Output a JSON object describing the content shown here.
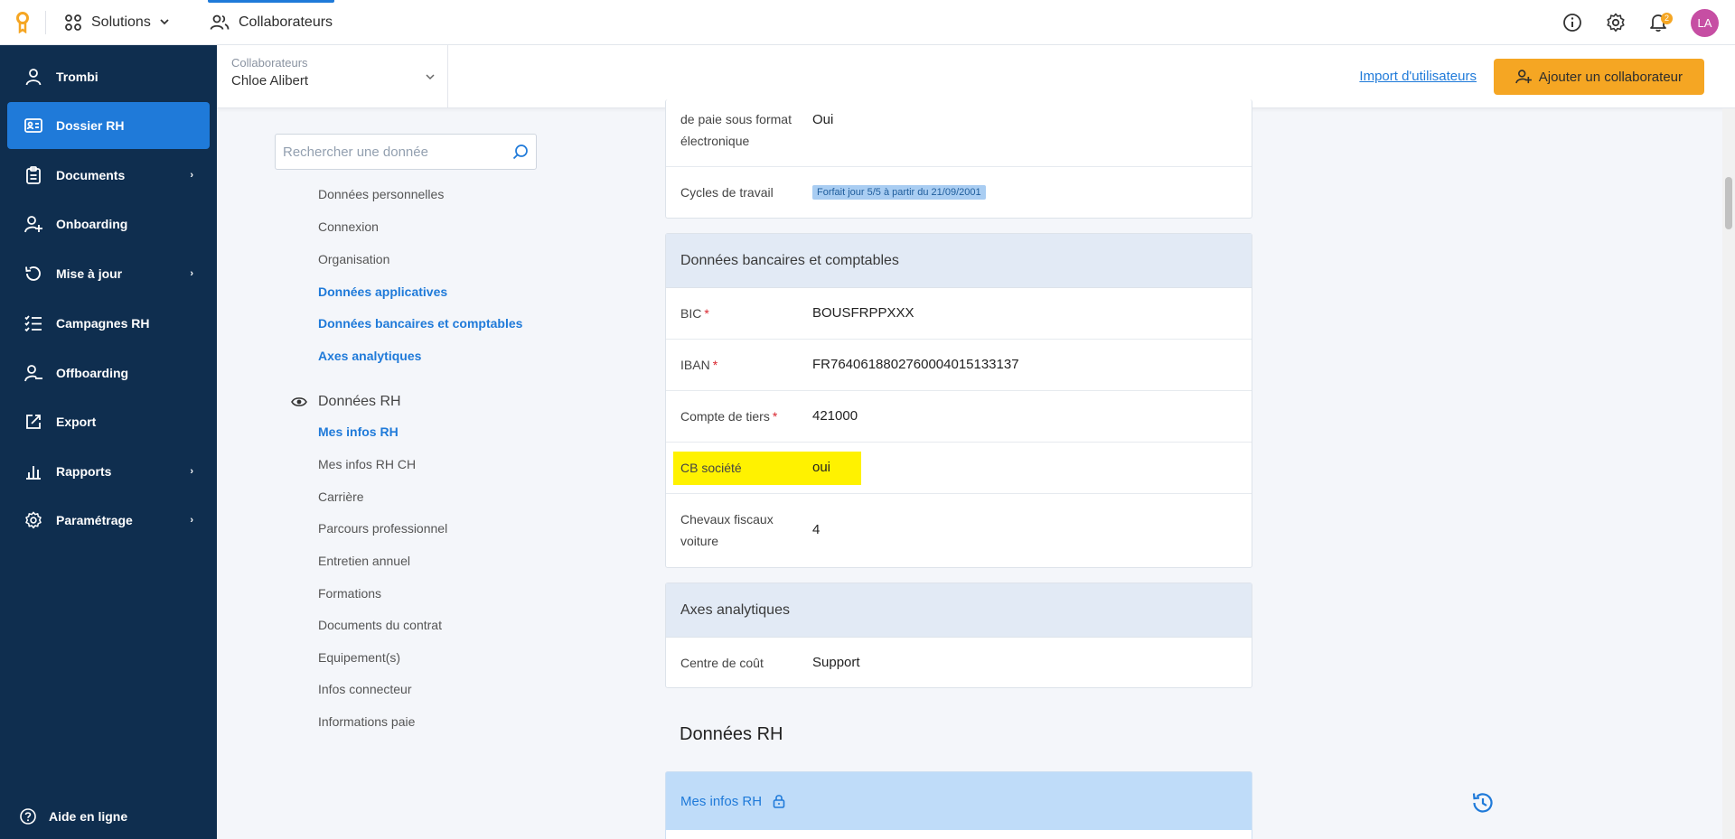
{
  "topbar": {
    "solutions_label": "Solutions",
    "module_label": "Collaborateurs",
    "notif_count": "2",
    "avatar_initials": "LA"
  },
  "sidebar": {
    "items": [
      {
        "label": "Trombi",
        "icon": "user-icon"
      },
      {
        "label": "Dossier RH",
        "icon": "id-card-icon"
      },
      {
        "label": "Documents",
        "icon": "clipboard-icon"
      },
      {
        "label": "Onboarding",
        "icon": "user-plus-icon"
      },
      {
        "label": "Mise à jour",
        "icon": "refresh-icon"
      },
      {
        "label": "Campagnes RH",
        "icon": "list-check-icon"
      },
      {
        "label": "Offboarding",
        "icon": "user-minus-icon"
      },
      {
        "label": "Export",
        "icon": "export-icon"
      },
      {
        "label": "Rapports",
        "icon": "bar-chart-icon"
      },
      {
        "label": "Paramétrage",
        "icon": "gear-icon"
      }
    ],
    "help_label": "Aide en ligne"
  },
  "subheader": {
    "collab_label": "Collaborateurs",
    "collab_value": "Chloe Alibert",
    "import_label": "Import d'utilisateurs",
    "add_label": "Ajouter un collaborateur"
  },
  "datanav": {
    "search_placeholder": "Rechercher une donnée",
    "items_top": [
      "Données personnelles",
      "Connexion",
      "Organisation",
      "Données applicatives",
      "Données bancaires et comptables",
      "Axes analytiques"
    ],
    "section_rh": "Données RH",
    "items_rh": [
      "Mes infos RH",
      "Mes infos RH CH",
      "Carrière",
      "Parcours professionnel",
      "Entretien annuel",
      "Formations",
      "Documents du contrat",
      "Equipement(s)",
      "Infos connecteur",
      "Informations paie"
    ]
  },
  "card_top": {
    "row1_label_a": "de paie sous format",
    "row1_label_b": "électronique",
    "row1_value": "Oui",
    "row2_label": "Cycles de travail",
    "row2_badge": "Forfait jour 5/5 à partir du 21/09/2001"
  },
  "card_bank": {
    "title": "Données bancaires et comptables",
    "bic_label": "BIC",
    "bic_value": "BOUSFRPPXXX",
    "iban_label": "IBAN",
    "iban_value": "FR7640618802760004015133137",
    "tiers_label": "Compte de tiers",
    "tiers_value": "421000",
    "cb_label": "CB société",
    "cb_value": "oui",
    "cv_label_a": "Chevaux fiscaux",
    "cv_label_b": "voiture",
    "cv_value": "4",
    "required_mark": "*"
  },
  "card_axes": {
    "title": "Axes analytiques",
    "cc_label": "Centre de coût",
    "cc_value": "Support"
  },
  "rh": {
    "section_title": "Données RH",
    "card_title": "Mes infos RH"
  },
  "colors": {
    "sidebar": "#0f2e4f",
    "active": "#1f7ad9",
    "accent": "#f5a623",
    "highlight": "#fff200"
  }
}
